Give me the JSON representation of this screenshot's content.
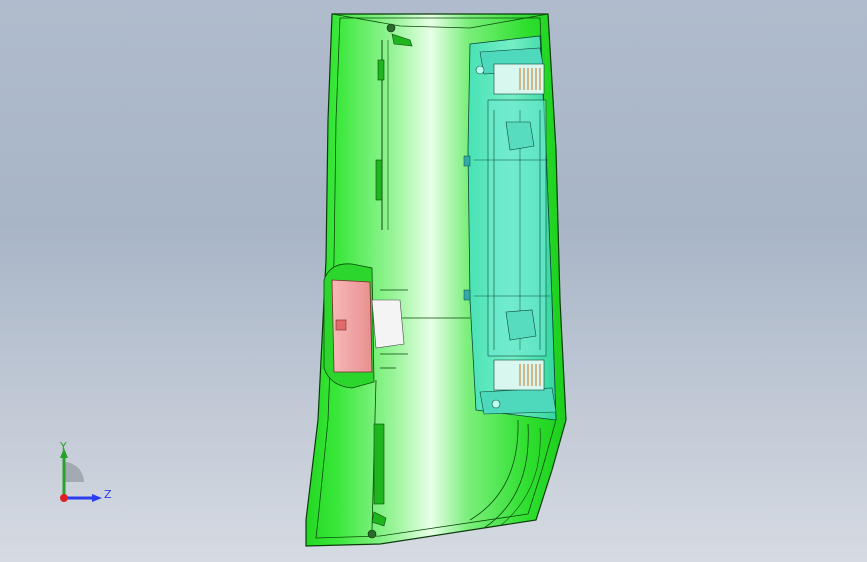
{
  "viewport": {
    "background_top": "#b0bccd",
    "background_bottom": "#d6dbe2"
  },
  "model": {
    "body_color": "#2ee02e",
    "body_highlight": "#e9ffe9",
    "edge_color": "#0a3a0a",
    "transparent_part_color": "#55e6c8",
    "handle_color": "#f3a3a3",
    "spring_color": "#c07a2a"
  },
  "triad": {
    "y_label": "Y",
    "z_label": "Z",
    "y_color": "#2aa12a",
    "z_color": "#2b3cf0",
    "x_color": "#e02020"
  }
}
